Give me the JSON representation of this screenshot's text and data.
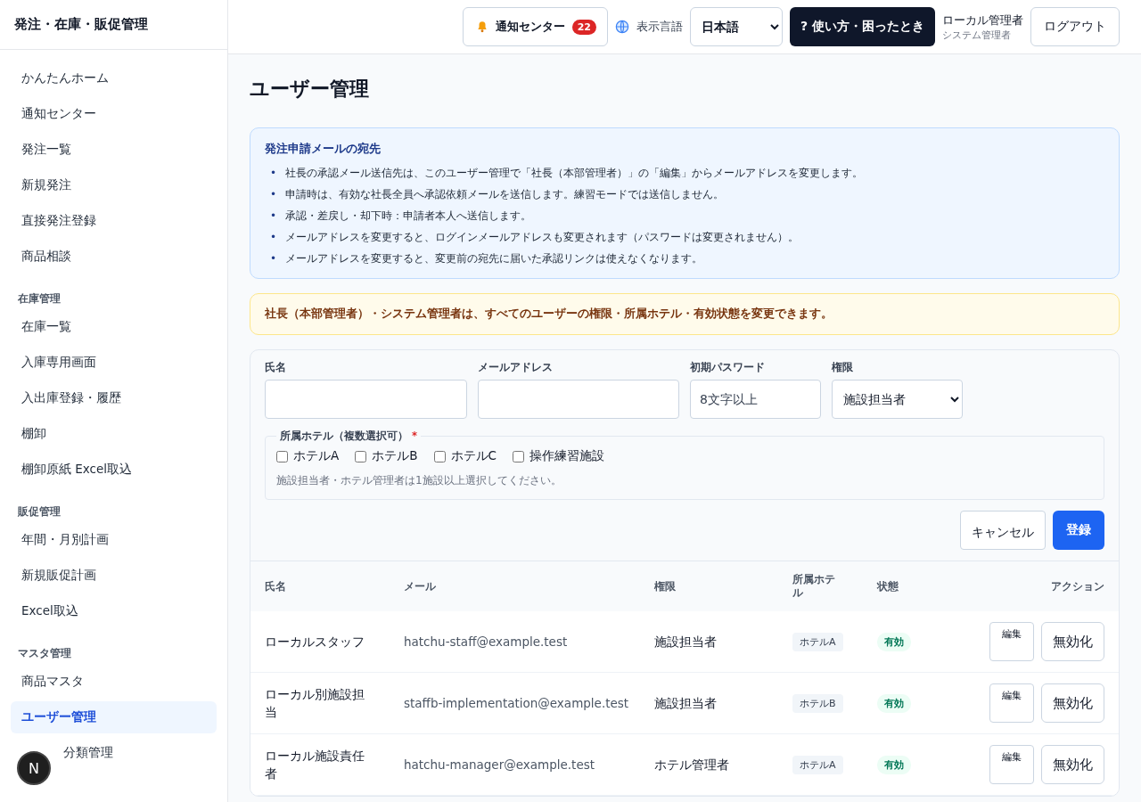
{
  "app_title": "発注・在庫・販促管理",
  "sidebar": {
    "sections": [
      {
        "items": [
          {
            "label": "かんたんホーム",
            "selected": false
          },
          {
            "label": "通知センター",
            "selected": false
          },
          {
            "label": "発注一覧",
            "selected": false
          },
          {
            "label": "新規発注",
            "selected": false
          },
          {
            "label": "直接発注登録",
            "selected": false
          },
          {
            "label": "商品相談",
            "selected": false
          }
        ]
      },
      {
        "heading": "在庫管理",
        "items": [
          {
            "label": "在庫一覧",
            "selected": false
          },
          {
            "label": "入庫専用画面",
            "selected": false
          },
          {
            "label": "入出庫登録・履歴",
            "selected": false
          },
          {
            "label": "棚卸",
            "selected": false
          },
          {
            "label": "棚卸原紙 Excel取込",
            "selected": false
          }
        ]
      },
      {
        "heading": "販促管理",
        "items": [
          {
            "label": "年間・月別計画",
            "selected": false
          },
          {
            "label": "新規販促計画",
            "selected": false
          },
          {
            "label": "Excel取込",
            "selected": false
          }
        ]
      },
      {
        "heading": "マスタ管理",
        "items": [
          {
            "label": "商品マスタ",
            "selected": false
          },
          {
            "label": "ユーザー管理",
            "selected": true
          },
          {
            "label": "分類管理",
            "selected": false
          }
        ]
      }
    ]
  },
  "floating_badge": "N",
  "topbar": {
    "notifications": {
      "label": "通知センター",
      "count": "22"
    },
    "language_label": "表示言語",
    "language": "日本語",
    "help": "? 使い方・困ったとき",
    "user_name": "ローカル管理者",
    "user_role": "システム管理者",
    "logout": "ログアウト"
  },
  "page_title": "ユーザー管理",
  "info_box": {
    "title": "発注申請メールの宛先",
    "bullet": "•",
    "items": [
      "社長の承認メール送信先は、このユーザー管理で「社長（本部管理者）」の「編集」からメールアドレスを変更します。",
      "申請時は、有効な社長全員へ承認依頼メールを送信します。練習モードでは送信しません。",
      "承認・差戻し・却下時：申請者本人へ送信します。",
      "メールアドレスを変更すると、ログインメールアドレスも変更されます（パスワードは変更されません）。",
      "メールアドレスを変更すると、変更前の宛先に届いた承認リンクは使えなくなります。"
    ]
  },
  "notice": "社長（本部管理者）・システム管理者は、すべてのユーザーの権限・所属ホテル・有効状態を変更できます。",
  "form": {
    "fields": [
      {
        "label": "氏名",
        "kind": "text"
      },
      {
        "label": "メールアドレス",
        "kind": "text"
      },
      {
        "label": "初期パスワード",
        "kind": "text",
        "placeholder": "8文字以上"
      },
      {
        "label": "権限",
        "kind": "select",
        "value": "施設担当者"
      }
    ],
    "hotels": {
      "legend": "所属ホテル（複数選択可）",
      "required_mark": "*",
      "options": [
        {
          "label": "ホテルA",
          "checked": false
        },
        {
          "label": "ホテルB",
          "checked": false
        },
        {
          "label": "ホテルC",
          "checked": false
        },
        {
          "label": "操作練習施設",
          "checked": false
        }
      ],
      "hint": "施設担当者・ホテル管理者は1施設以上選択してください。"
    },
    "cancel": "キャンセル",
    "submit": "登録"
  },
  "table": {
    "columns": [
      "氏名",
      "メール",
      "権限",
      "所属ホテル",
      "状態",
      "アクション"
    ],
    "rows": [
      {
        "name": "ローカルスタッフ",
        "email": "hatchu-staff@example.test",
        "role": "施設担当者",
        "hotel": "ホテルA",
        "status": "有効",
        "edit": "編集",
        "disable": "無効化"
      },
      {
        "name": "ローカル別施設担当",
        "email": "staffb-implementation@example.test",
        "role": "施設担当者",
        "hotel": "ホテルB",
        "status": "有効",
        "edit": "編集",
        "disable": "無効化"
      },
      {
        "name": "ローカル施設責任者",
        "email": "hatchu-manager@example.test",
        "role": "ホテル管理者",
        "hotel": "ホテルA",
        "status": "有効",
        "edit": "編集",
        "disable": "無効化"
      }
    ]
  }
}
